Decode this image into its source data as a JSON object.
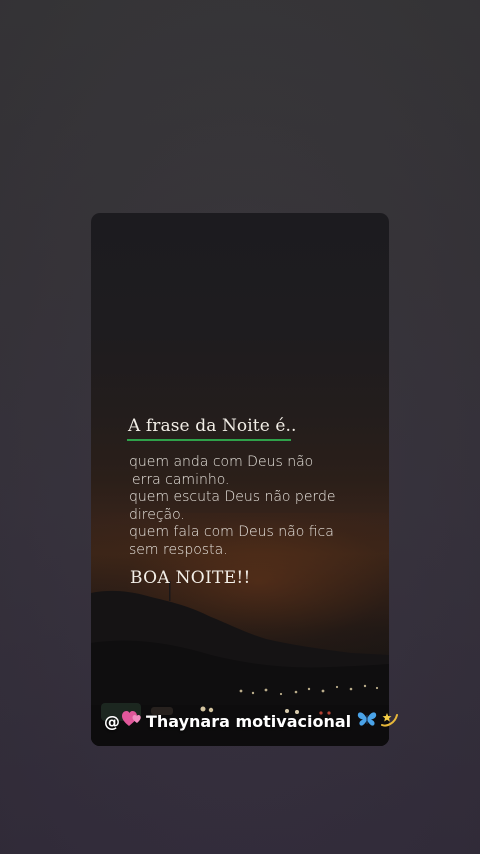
{
  "post": {
    "title": "A frase da Noite é..",
    "quote_lines": [
      "quem anda com Deus não",
      "erra caminho.",
      "quem escuta Deus não perde",
      "direção.",
      "quem fala com Deus não fica",
      "sem resposta."
    ],
    "closing": "BOA NOITE!!"
  },
  "watermark": {
    "at": "@",
    "name": "Thaynara motivacional",
    "icons": [
      "two-hearts-icon",
      "butterfly-icon",
      "dizzy-star-icon"
    ]
  },
  "colors": {
    "underline": "#2fa24a",
    "text": "#f1ede6",
    "background": "#3a3640"
  }
}
